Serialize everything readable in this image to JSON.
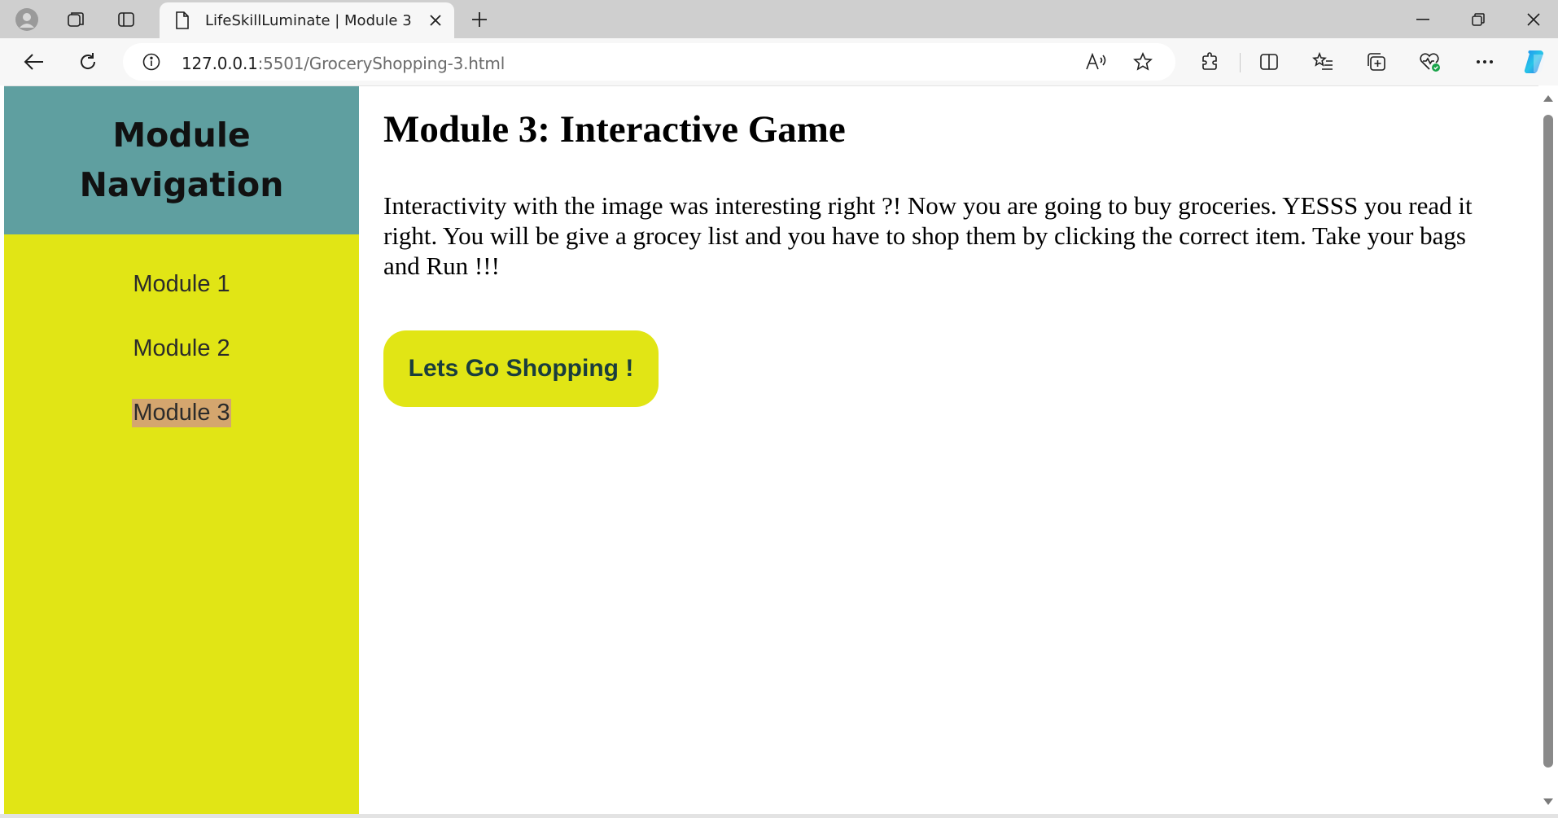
{
  "browser": {
    "tab_title": "LifeSkillLuminate | Module 3",
    "url_host": "127.0.0.1",
    "url_path": ":5501/GroceryShopping-3.html"
  },
  "sidebar": {
    "title": "Module Navigation",
    "items": [
      {
        "label": "Module 1",
        "active": false
      },
      {
        "label": "Module 2",
        "active": false
      },
      {
        "label": "Module 3",
        "active": true
      }
    ]
  },
  "main": {
    "heading": "Module 3: Interactive Game",
    "intro": "Interactivity with the image was interesting right ?! Now you are going to buy groceries. YESSS you read it right. You will be give a grocey list and you have to shop them by clicking the correct item. Take your bags and Run !!!",
    "cta_label": "Lets Go Shopping !"
  },
  "colors": {
    "sidebar_bg": "#e1e515",
    "sidebar_header_bg": "#5f9fa0",
    "active_highlight": "#d4a66e",
    "button_bg": "#e1e515",
    "button_text": "#1a3d3d"
  }
}
